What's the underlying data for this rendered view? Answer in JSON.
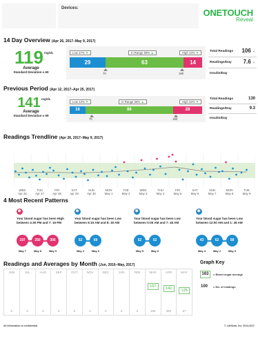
{
  "header": {
    "devices_label": "Devices:",
    "logo_text": "ONETOUCH",
    "logo_sub": "Reveal",
    "brand_color": "#2db34a"
  },
  "overview": {
    "title": "14 Day Overview",
    "date_range": "(Apr 26, 2017–May 9, 2017)",
    "average": "119",
    "unit": "mg/dL",
    "average_label": "Average",
    "sd_label": "Standard Deviation ± 60",
    "tags": {
      "low": "Low 27%",
      "in_range": "In Range 59%",
      "high": "High 14%"
    },
    "bar": {
      "low": "29",
      "in_range": "63",
      "high": "14"
    },
    "share": {
      "low": 0.27,
      "in_range": 0.59,
      "high": 0.14
    },
    "thresholds": {
      "low": "70",
      "high": "180"
    },
    "stats": [
      {
        "label": "Total Readings",
        "value": "106"
      },
      {
        "label": "Readings/Day",
        "value": "7.6"
      },
      {
        "label": "Insulin/Day",
        "value": ""
      }
    ]
  },
  "previous": {
    "title": "Previous Period",
    "date_range": "(Apr 12, 2017–Apr 25, 2017)",
    "average": "141",
    "unit": "mg/dL",
    "average_label": "Average",
    "sd_label": "Standard Deviation ± 59",
    "tags": {
      "low": "Low 12%",
      "in_range": "In Range 66%",
      "high": "High 22%"
    },
    "bar": {
      "low": "16",
      "in_range": "86",
      "high": "28"
    },
    "share": {
      "low": 0.12,
      "in_range": 0.66,
      "high": 0.22
    },
    "thresholds": {
      "low": "70",
      "high": "180"
    },
    "stats": [
      {
        "label": "Total Readings",
        "value": "130"
      },
      {
        "label": "Readings/Day",
        "value": "9.3"
      },
      {
        "label": "Insulin/Day",
        "value": ""
      }
    ]
  },
  "colors": {
    "low": "#1d8ed1",
    "in_range": "#6bbd45",
    "high": "#e2336e"
  },
  "trend": {
    "title": "Readings Trendline",
    "date_range": "(Apr 26, 2017–May 9, 2017)",
    "days": [
      {
        "wd": "WED",
        "d": "Apr 26"
      },
      {
        "wd": "THU",
        "d": "Apr 27"
      },
      {
        "wd": "FRI",
        "d": "Apr 28"
      },
      {
        "wd": "SAT",
        "d": "Apr 29"
      },
      {
        "wd": "SUN",
        "d": "Apr 30"
      },
      {
        "wd": "MON",
        "d": "May 1"
      },
      {
        "wd": "TUE",
        "d": "May 2"
      },
      {
        "wd": "WED",
        "d": "May 3"
      },
      {
        "wd": "THU",
        "d": "May 4"
      },
      {
        "wd": "FRI",
        "d": "May 5"
      },
      {
        "wd": "SAT",
        "d": "May 6"
      },
      {
        "wd": "SUN",
        "d": "May 7"
      },
      {
        "wd": "MON",
        "d": "May 8"
      },
      {
        "wd": "TUE",
        "d": "May 9"
      }
    ]
  },
  "chart_data": {
    "type": "scatter",
    "title": "Readings Trendline",
    "y_range": [
      0,
      250
    ],
    "target_range": [
      70,
      180
    ],
    "x_unit": "day index (0 = Apr 26)",
    "points": [
      {
        "x": 0.1,
        "y": 120
      },
      {
        "x": 0.3,
        "y": 95
      },
      {
        "x": 0.5,
        "y": 140
      },
      {
        "x": 0.7,
        "y": 110
      },
      {
        "x": 0.9,
        "y": 75
      },
      {
        "x": 1.1,
        "y": 130
      },
      {
        "x": 1.3,
        "y": 88
      },
      {
        "x": 1.5,
        "y": 60
      },
      {
        "x": 1.7,
        "y": 115
      },
      {
        "x": 1.9,
        "y": 100
      },
      {
        "x": 2.1,
        "y": 145
      },
      {
        "x": 2.3,
        "y": 125
      },
      {
        "x": 2.6,
        "y": 90
      },
      {
        "x": 2.9,
        "y": 65
      },
      {
        "x": 3.1,
        "y": 135
      },
      {
        "x": 3.4,
        "y": 110
      },
      {
        "x": 3.6,
        "y": 80
      },
      {
        "x": 3.9,
        "y": 120
      },
      {
        "x": 4.1,
        "y": 100
      },
      {
        "x": 4.3,
        "y": 55
      },
      {
        "x": 4.6,
        "y": 130
      },
      {
        "x": 4.9,
        "y": 90
      },
      {
        "x": 5.1,
        "y": 115
      },
      {
        "x": 5.4,
        "y": 85
      },
      {
        "x": 5.7,
        "y": 125
      },
      {
        "x": 5.9,
        "y": 150
      },
      {
        "x": 6.1,
        "y": 95
      },
      {
        "x": 6.4,
        "y": 185
      },
      {
        "x": 6.6,
        "y": 120
      },
      {
        "x": 6.9,
        "y": 75
      },
      {
        "x": 7.1,
        "y": 110
      },
      {
        "x": 7.4,
        "y": 200
      },
      {
        "x": 7.6,
        "y": 140
      },
      {
        "x": 7.9,
        "y": 95
      },
      {
        "x": 8.1,
        "y": 130
      },
      {
        "x": 8.3,
        "y": 210
      },
      {
        "x": 8.5,
        "y": 155
      },
      {
        "x": 8.8,
        "y": 100
      },
      {
        "x": 9.0,
        "y": 225
      },
      {
        "x": 9.2,
        "y": 240
      },
      {
        "x": 9.4,
        "y": 190
      },
      {
        "x": 9.6,
        "y": 130
      },
      {
        "x": 9.8,
        "y": 60
      },
      {
        "x": 10.1,
        "y": 120
      },
      {
        "x": 10.4,
        "y": 170
      },
      {
        "x": 10.6,
        "y": 95
      },
      {
        "x": 10.9,
        "y": 135
      },
      {
        "x": 11.1,
        "y": 105
      },
      {
        "x": 11.4,
        "y": 80
      },
      {
        "x": 11.7,
        "y": 145
      },
      {
        "x": 11.9,
        "y": 115
      },
      {
        "x": 12.1,
        "y": 120
      },
      {
        "x": 12.3,
        "y": 185
      },
      {
        "x": 12.5,
        "y": 65
      },
      {
        "x": 12.7,
        "y": 140
      },
      {
        "x": 12.9,
        "y": 95
      },
      {
        "x": 13.2,
        "y": 110
      },
      {
        "x": 13.5,
        "y": 130
      }
    ],
    "trend": [
      {
        "x": 0,
        "y": 110
      },
      {
        "x": 2,
        "y": 112
      },
      {
        "x": 4,
        "y": 108
      },
      {
        "x": 6,
        "y": 118
      },
      {
        "x": 8,
        "y": 135
      },
      {
        "x": 9.3,
        "y": 150
      },
      {
        "x": 11,
        "y": 120
      },
      {
        "x": 13.5,
        "y": 115
      }
    ]
  },
  "patterns": {
    "title": "4 Most Recent Patterns",
    "items": [
      {
        "type": "high",
        "text": "Your blood sugar has been High between 4:30 PM and 7: 15 PM",
        "values": [
          "197",
          "250",
          "306"
        ],
        "dates": [
          "May 7",
          "May 8",
          "May 9"
        ]
      },
      {
        "type": "low",
        "text": "Your blood sugar has been Low between 6:15 AM and 8: 30 AM",
        "values": [
          "52",
          "69"
        ],
        "dates": [
          "May 2",
          "May 6"
        ]
      },
      {
        "type": "low",
        "text": "Your blood sugar has been Low between 0:00 AM and 7: 45 AM",
        "values": [
          "52",
          "52"
        ],
        "dates": [
          "May 5",
          "May 6"
        ]
      },
      {
        "type": "low",
        "text": "Your blood sugar has been Low between 12:00 AM and 1: 45 AM",
        "values": [
          "43",
          "62",
          "58"
        ],
        "dates": [
          "May 4",
          "May 2",
          "May 3"
        ]
      }
    ]
  },
  "monthly": {
    "title": "Readings and Averages by Month",
    "date_range": "(Jun, 2016–May, 2017)",
    "months": [
      {
        "name": "JUN",
        "count": "0",
        "avg": null
      },
      {
        "name": "JUL",
        "count": "0",
        "avg": null
      },
      {
        "name": "AUG",
        "count": "0",
        "avg": null
      },
      {
        "name": "SEP",
        "count": "0",
        "avg": null
      },
      {
        "name": "OCT",
        "count": "0",
        "avg": null
      },
      {
        "name": "NOV",
        "count": "0",
        "avg": null
      },
      {
        "name": "DEC",
        "count": "0",
        "avg": null
      },
      {
        "name": "JAN",
        "count": "0",
        "avg": null
      },
      {
        "name": "FEB",
        "count": "0",
        "avg": null
      },
      {
        "name": "MAR",
        "count": "196",
        "avg": 167
      },
      {
        "name": "APR",
        "count": "383",
        "avg": 142
      },
      {
        "name": "MAY",
        "count": "67",
        "avg": 125
      }
    ]
  },
  "key": {
    "title": "Graph Key",
    "avg_example": "163",
    "avg_desc": "= Blood sugar average",
    "count_example": "100",
    "count_desc": "= No. of readings"
  },
  "footer": {
    "left": "All information is confidential.",
    "right": "© LifeScan, Inc. 2013-2017"
  }
}
